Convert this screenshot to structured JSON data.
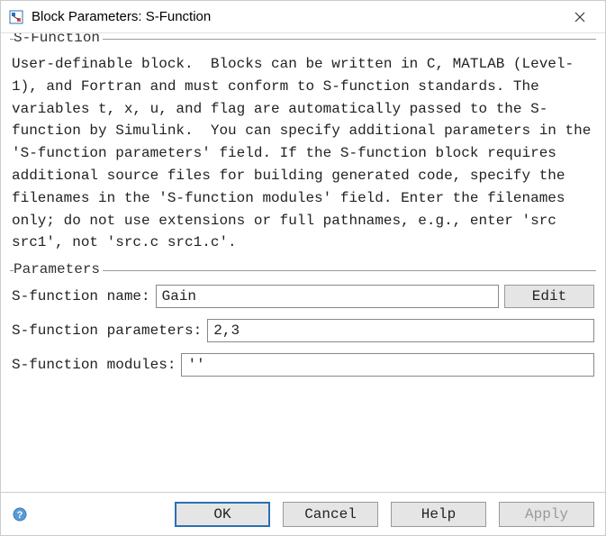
{
  "window": {
    "title": "Block Parameters: S-Function"
  },
  "sfunction_section": {
    "legend": "S-Function",
    "description": "User-definable block.  Blocks can be written in C, MATLAB (Level-1), and Fortran and must conform to S-function standards. The variables t, x, u, and flag are automatically passed to the S-function by Simulink.  You can specify additional parameters in the 'S-function parameters' field. If the S-function block requires additional source files for building generated code, specify the filenames in the 'S-function modules' field. Enter the filenames only; do not use extensions or full pathnames, e.g., enter 'src src1', not 'src.c src1.c'."
  },
  "parameters_section": {
    "legend": "Parameters",
    "name_label": "S-function name:",
    "name_value": "Gain",
    "edit_label": "Edit",
    "params_label": "S-function parameters:",
    "params_value": "2,3",
    "modules_label": "S-function modules:",
    "modules_value": "''"
  },
  "buttons": {
    "ok": "OK",
    "cancel": "Cancel",
    "help": "Help",
    "apply": "Apply"
  }
}
